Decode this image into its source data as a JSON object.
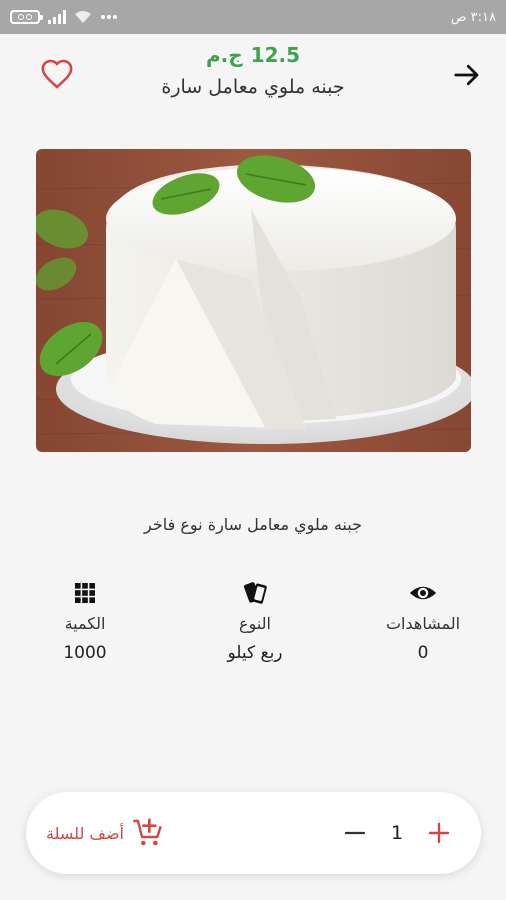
{
  "status_bar": {
    "time": "٣:١٨ ص"
  },
  "header": {
    "price_value": "12.5",
    "price_currency": "ج.م",
    "title": "جبنه ملوي معامل سارة"
  },
  "product": {
    "description": "جبنه ملوي معامل سارة نوع فاخر"
  },
  "stats": {
    "views_label": "المشاهدات",
    "views_value": "0",
    "type_label": "النوع",
    "type_value": "ربع كيلو",
    "quantity_label": "الكمية",
    "quantity_value": "1000"
  },
  "cart": {
    "add_label": "أضف للسلة",
    "quantity": "1"
  },
  "icons": {
    "back": "arrow-forward-icon",
    "favorite": "heart-outline-icon",
    "views": "eye-icon",
    "type": "cards-icon",
    "quantity": "grid-icon",
    "add_to_cart": "cart-plus-icon",
    "increase": "plus-icon",
    "decrease": "minus-icon"
  },
  "colors": {
    "price": "#3fa34d",
    "accent": "#d64545",
    "status_bar": "#a7a7a7",
    "background": "#f5f5f5"
  }
}
